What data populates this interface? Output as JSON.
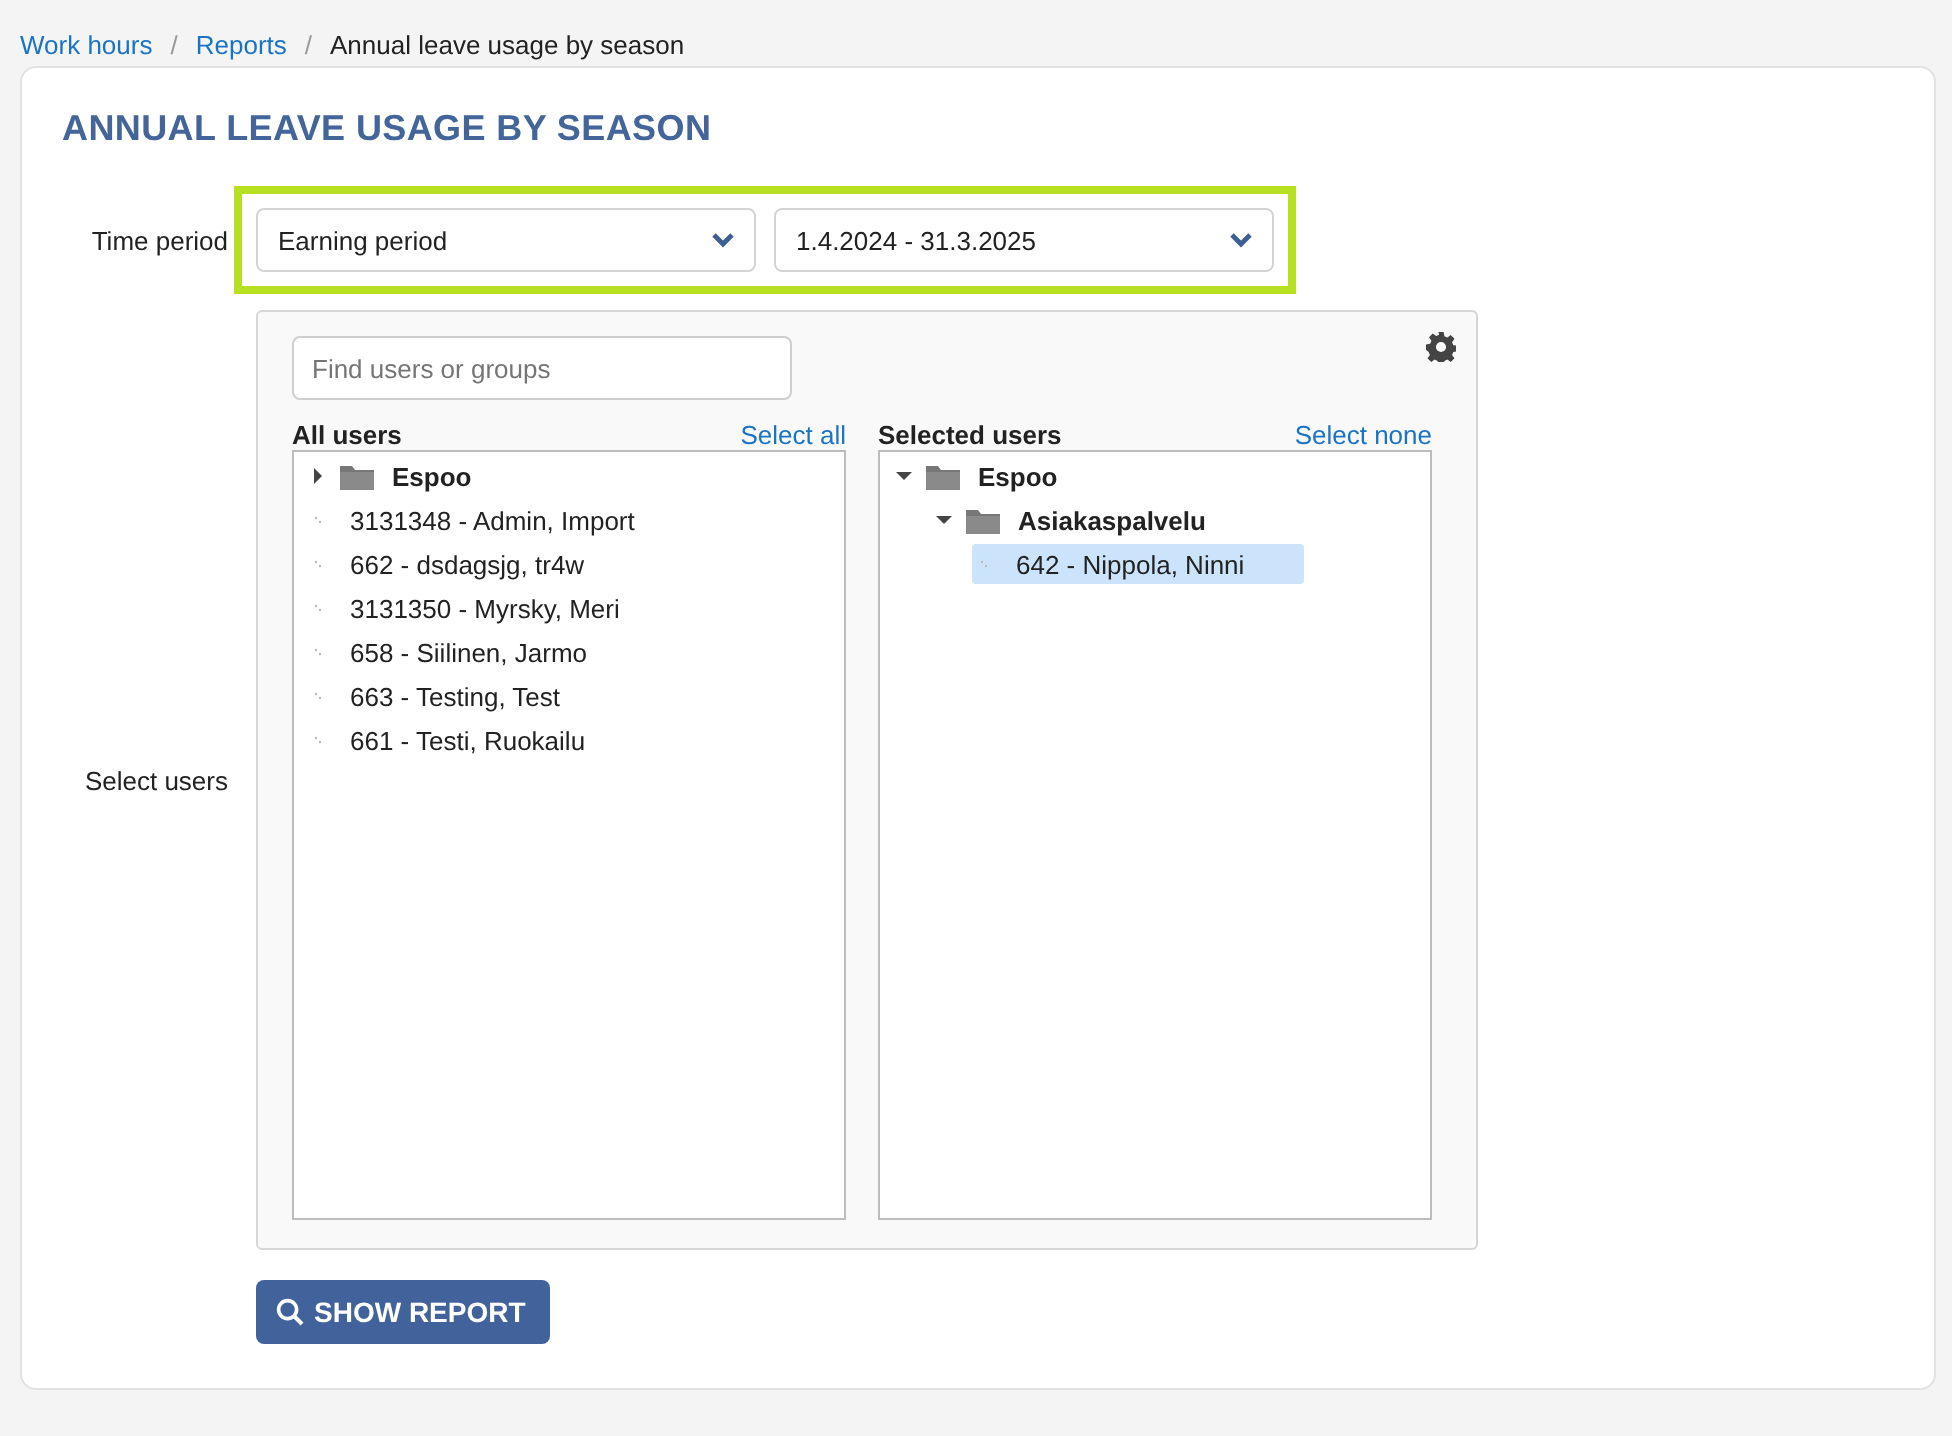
{
  "breadcrumb_separator": "/",
  "breadcrumb": [
    {
      "label": "Work hours",
      "kind": "link"
    },
    {
      "label": "Reports",
      "kind": "link"
    },
    {
      "label": "Annual leave usage by season",
      "kind": "current"
    }
  ],
  "title": "ANNUAL LEAVE USAGE BY SEASON",
  "time_period": {
    "label": "Time period",
    "highlighted": true,
    "period_type": "Earning period",
    "period_range": "1.4.2024 - 31.3.2025"
  },
  "select_users": {
    "label": "Select users",
    "search": {
      "placeholder": "Find users or groups"
    },
    "all_users": {
      "title": "All users",
      "action": "Select all",
      "items": [
        {
          "kind": "group",
          "name": "Espoo",
          "expanded": false
        },
        {
          "kind": "user",
          "name": "3131348 - Admin, Import",
          "selected": false
        },
        {
          "kind": "user",
          "name": "662 - dsdagsjg, tr4w",
          "selected": false
        },
        {
          "kind": "user",
          "name": "3131350 - Myrsky, Meri",
          "selected": false
        },
        {
          "kind": "user",
          "name": "658 - Siilinen, Jarmo",
          "selected": false
        },
        {
          "kind": "user",
          "name": "663 - Testing, Test",
          "selected": false
        },
        {
          "kind": "user",
          "name": "661 - Testi, Ruokailu",
          "selected": false
        }
      ]
    },
    "selected_users": {
      "title": "Selected users",
      "action": "Select none",
      "items": [
        {
          "kind": "group",
          "name": "Espoo",
          "expanded": true,
          "children": [
            {
              "kind": "group",
              "name": "Asiakaspalvelu",
              "expanded": true,
              "children": [
                {
                  "kind": "user",
                  "name": "642 - Nippola, Ninni",
                  "selected": true
                }
              ]
            }
          ]
        }
      ]
    }
  },
  "show_report_button": "SHOW REPORT"
}
